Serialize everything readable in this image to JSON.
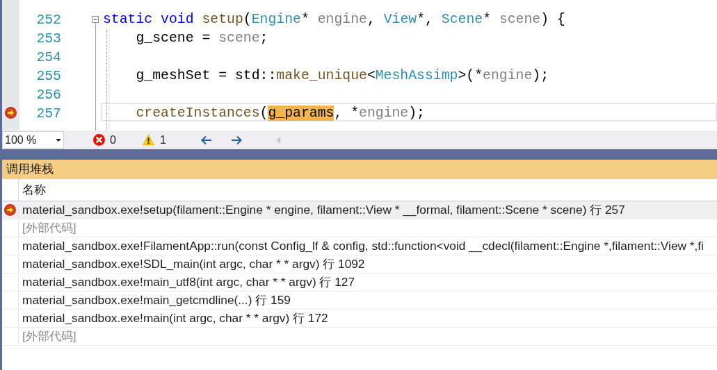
{
  "editor": {
    "lines": [
      {
        "number": "252",
        "expanded": true,
        "current": false,
        "tokens": [
          {
            "text": "static void",
            "kind": "keyword"
          },
          {
            "text": " setup",
            "kind": "function"
          },
          {
            "text": "(",
            "kind": "plain"
          },
          {
            "text": "Engine",
            "kind": "type"
          },
          {
            "text": "* ",
            "kind": "plain"
          },
          {
            "text": "engine",
            "kind": "param"
          },
          {
            "text": ", ",
            "kind": "plain"
          },
          {
            "text": "View",
            "kind": "type"
          },
          {
            "text": "*, ",
            "kind": "plain"
          },
          {
            "text": "Scene",
            "kind": "type"
          },
          {
            "text": "* ",
            "kind": "plain"
          },
          {
            "text": "scene",
            "kind": "param"
          },
          {
            "text": ") {",
            "kind": "plain"
          }
        ]
      },
      {
        "number": "253",
        "current": false,
        "tokens": [
          {
            "text": "    g_scene = ",
            "kind": "plain"
          },
          {
            "text": "scene",
            "kind": "param"
          },
          {
            "text": ";",
            "kind": "plain"
          }
        ]
      },
      {
        "number": "254",
        "current": false
      },
      {
        "number": "255",
        "current": false,
        "tokens": [
          {
            "text": "    g_meshSet = std::",
            "kind": "plain"
          },
          {
            "text": "make_unique",
            "kind": "function"
          },
          {
            "text": "<",
            "kind": "plain"
          },
          {
            "text": "MeshAssimp",
            "kind": "type"
          },
          {
            "text": ">(*",
            "kind": "plain"
          },
          {
            "text": "engine",
            "kind": "param"
          },
          {
            "text": ");",
            "kind": "plain"
          }
        ]
      },
      {
        "number": "256",
        "current": false
      },
      {
        "number": "257",
        "current": true,
        "tokens": [
          {
            "text": "    createInstances",
            "kind": "function"
          },
          {
            "text": "(",
            "kind": "plain"
          },
          {
            "text": "g_params",
            "kind": "highlight"
          },
          {
            "text": ", *",
            "kind": "plain"
          },
          {
            "text": "engine",
            "kind": "param"
          },
          {
            "text": ");",
            "kind": "plain"
          }
        ]
      }
    ]
  },
  "status_bar": {
    "zoom": "100 %",
    "errors": "0",
    "warnings": "1"
  },
  "call_stack": {
    "title": "调用堆栈",
    "columns": [
      "名称"
    ],
    "rows": [
      {
        "text": "material_sandbox.exe!setup(filament::Engine * engine, filament::View * __formal, filament::Scene * scene) 行 257",
        "kind": "frame",
        "current": true,
        "selected": true
      },
      {
        "text": "[外部代码]",
        "kind": "external",
        "current": false,
        "selected": false
      },
      {
        "text": "material_sandbox.exe!FilamentApp::run(const Config_lf & config, std::function<void __cdecl(filament::Engine *,filament::View *,fi",
        "kind": "frame",
        "current": false,
        "selected": false
      },
      {
        "text": "material_sandbox.exe!SDL_main(int argc, char * * argv) 行 1092",
        "kind": "frame",
        "current": false,
        "selected": false
      },
      {
        "text": "material_sandbox.exe!main_utf8(int argc, char * * argv) 行 127",
        "kind": "frame",
        "current": false,
        "selected": false
      },
      {
        "text": "material_sandbox.exe!main_getcmdline(...) 行 159",
        "kind": "frame",
        "current": false,
        "selected": false
      },
      {
        "text": "material_sandbox.exe!main(int argc, char * * argv) 行 172",
        "kind": "frame",
        "current": false,
        "selected": false
      },
      {
        "text": "[外部代码]",
        "kind": "external",
        "current": false,
        "selected": false
      }
    ]
  }
}
